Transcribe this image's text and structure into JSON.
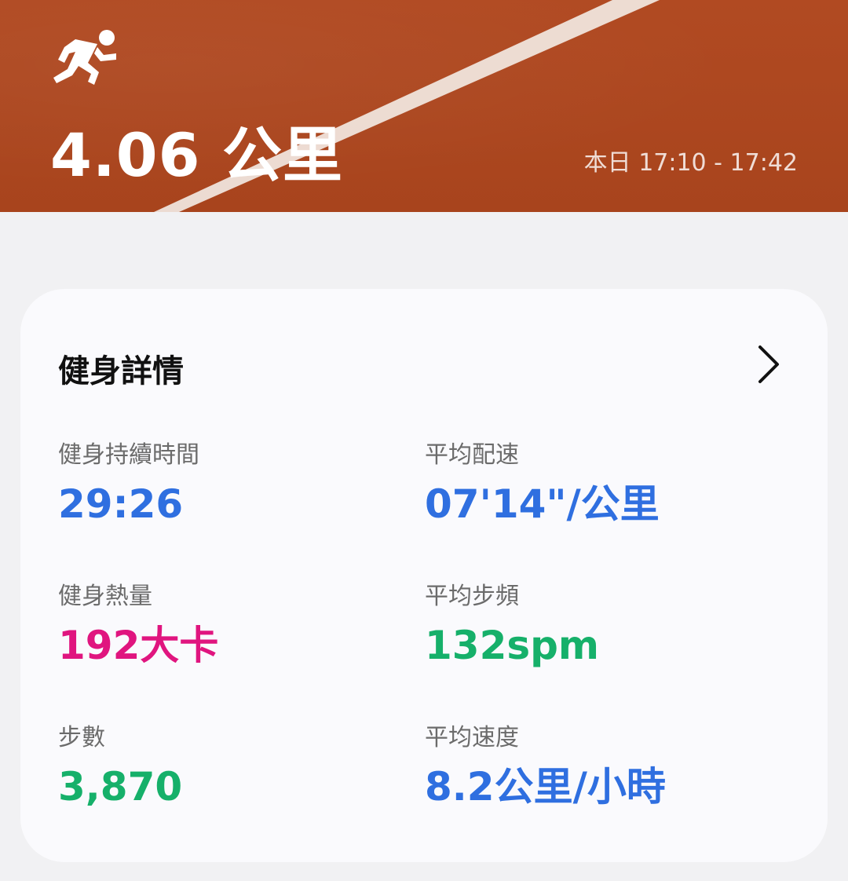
{
  "header": {
    "distance": "4.06 公里",
    "time_range": "本日 17:10 - 17:42",
    "activity_icon": "running-person-icon",
    "background_color": "#ad461f"
  },
  "card": {
    "title": "健身詳情",
    "chevron_icon": "chevron-right-icon",
    "stats": [
      {
        "label": "健身持續時間",
        "value": "29:26",
        "color": "#2f6fe0"
      },
      {
        "label": "平均配速",
        "value": "07'14\"/公里",
        "color": "#2f6fe0"
      },
      {
        "label": "健身熱量",
        "value": "192大卡",
        "color": "#e0157f"
      },
      {
        "label": "平均步頻",
        "value": "132spm",
        "color": "#16b06a"
      },
      {
        "label": "步數",
        "value": "3,870",
        "color": "#16b06a"
      },
      {
        "label": "平均速度",
        "value": "8.2公里/小時",
        "color": "#2f6fe0"
      }
    ]
  }
}
